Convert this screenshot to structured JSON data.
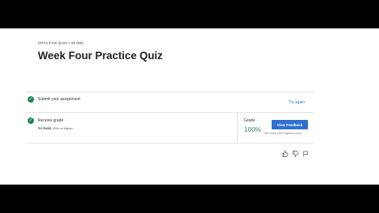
{
  "header": {
    "eyebrow": "PRACTICE QUIZ • 30 MIN",
    "title": "Week Four Practice Quiz"
  },
  "submit": {
    "label": "Submit your assignment",
    "try_again": "Try again"
  },
  "grade_row": {
    "label": "Receive grade",
    "to_pass_label": "TO PASS",
    "to_pass_value": "80% or higher",
    "grade_label": "Grade",
    "grade_value": "100%",
    "button": "View Feedback",
    "note": "We keep your highest score"
  },
  "icons": {
    "check": "check-circle-icon",
    "like": "thumbs-up-icon",
    "dislike": "thumbs-down-icon",
    "report": "flag-icon"
  },
  "colors": {
    "accent": "#2f6fd0",
    "success": "#1f8354",
    "link": "#2a73cc"
  }
}
